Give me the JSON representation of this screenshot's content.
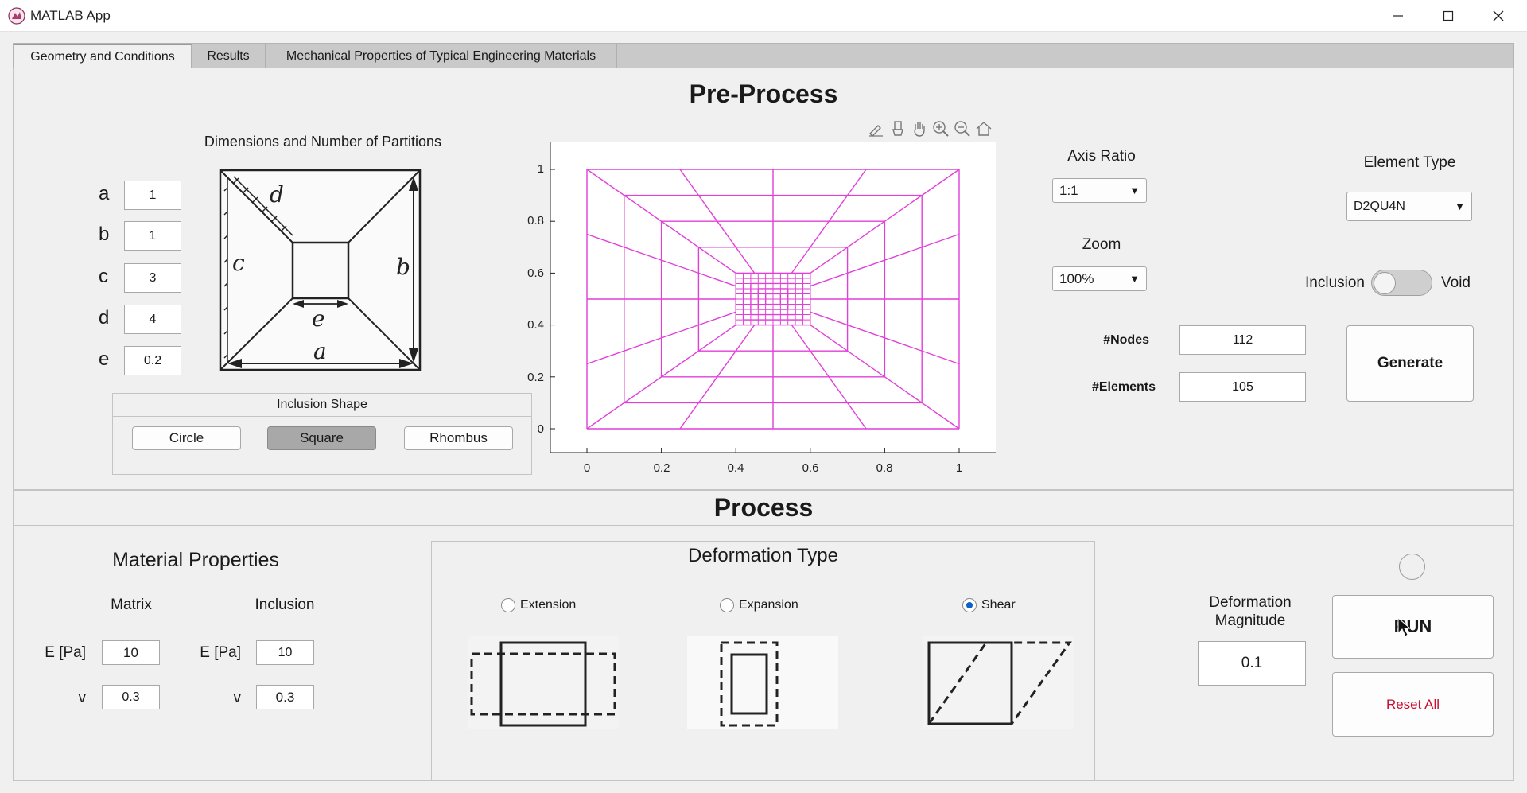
{
  "window": {
    "title": "MATLAB App"
  },
  "tabs": [
    {
      "label": "Geometry and Conditions",
      "active": true
    },
    {
      "label": "Results",
      "active": false
    },
    {
      "label": "Mechanical Properties of Typical Engineering Materials",
      "active": false
    }
  ],
  "preprocess": {
    "heading": "Pre-Process",
    "dimensions": {
      "title": "Dimensions and Number of Partitions",
      "rows": [
        {
          "label": "a",
          "value": "1"
        },
        {
          "label": "b",
          "value": "1"
        },
        {
          "label": "c",
          "value": "3"
        },
        {
          "label": "d",
          "value": "4"
        },
        {
          "label": "e",
          "value": "0.2"
        }
      ],
      "diagram_labels": {
        "a": "a",
        "b": "b",
        "c": "c",
        "d": "d",
        "e": "e"
      }
    },
    "inclusion_shape": {
      "title": "Inclusion Shape",
      "options": [
        "Circle",
        "Square",
        "Rhombus"
      ],
      "selected": "Square"
    },
    "plot": {
      "xticks": [
        "0",
        "0.2",
        "0.4",
        "0.6",
        "0.8",
        "1"
      ],
      "yticks": [
        "0",
        "0.2",
        "0.4",
        "0.6",
        "0.8",
        "1"
      ],
      "mesh_color": "#e23fd9",
      "toolbar_icons": [
        "brush-icon",
        "data-tip-icon",
        "pan-icon",
        "zoom-in-icon",
        "zoom-out-icon",
        "home-icon"
      ]
    },
    "axis_ratio": {
      "label": "Axis Ratio",
      "value": "1:1"
    },
    "zoom": {
      "label": "Zoom",
      "value": "100%"
    },
    "element_type": {
      "label": "Element Type",
      "value": "D2QU4N"
    },
    "switch": {
      "left": "Inclusion",
      "right": "Void",
      "state": "Inclusion"
    },
    "nodes": {
      "label": "#Nodes",
      "value": "112"
    },
    "elements": {
      "label": "#Elements",
      "value": "105"
    },
    "generate_label": "Generate"
  },
  "process": {
    "heading": "Process",
    "material": {
      "title": "Material Properties",
      "matrix_label": "Matrix",
      "inclusion_label": "Inclusion",
      "e_label": "E [Pa]",
      "v_label": "v",
      "matrix_E": "10",
      "matrix_v": "0.3",
      "inclusion_E": "10",
      "inclusion_v": "0.3"
    },
    "deformation": {
      "title": "Deformation Type",
      "options": [
        {
          "label": "Extension",
          "selected": false
        },
        {
          "label": "Expansion",
          "selected": false
        },
        {
          "label": "Shear",
          "selected": true
        }
      ]
    },
    "magnitude": {
      "label_line1": "Deformation",
      "label_line2": "Magnitude",
      "value": "0.1"
    },
    "run_label": "RUN",
    "reset_label": "Reset All"
  },
  "colors": {
    "accent_radio": "#0b63c9",
    "reset_text": "#c8102e",
    "panel_bg": "#f0f0f0"
  }
}
